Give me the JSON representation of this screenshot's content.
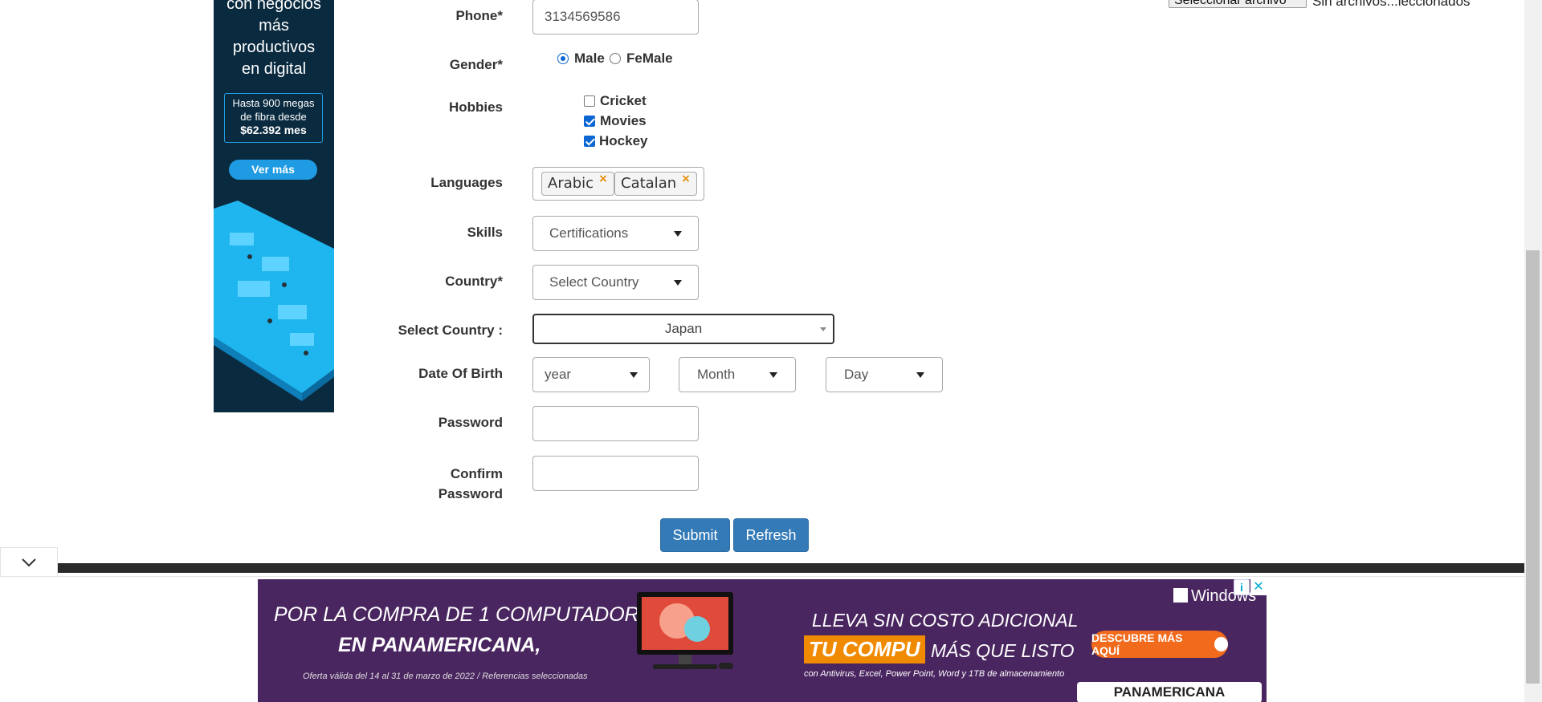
{
  "side_ad": {
    "heading_lines": [
      "con negocios",
      "más",
      "productivos",
      "en digital"
    ],
    "offer_line1": "Hasta 900 megas",
    "offer_line2": "de fibra desde",
    "offer_price": "$62.392 mes",
    "cta": "Ver más"
  },
  "file_upload": {
    "button_label": "Seleccionar archivo",
    "status": "Sin archivos...leccionados"
  },
  "form": {
    "phone": {
      "label": "Phone*",
      "value": "3134569586"
    },
    "gender": {
      "label": "Gender*",
      "options": [
        "Male",
        "FeMale"
      ],
      "selected": "Male"
    },
    "hobbies": {
      "label": "Hobbies",
      "items": [
        {
          "label": "Cricket",
          "checked": false
        },
        {
          "label": "Movies",
          "checked": true
        },
        {
          "label": "Hockey",
          "checked": true
        }
      ]
    },
    "languages": {
      "label": "Languages",
      "tags": [
        "Arabic",
        "Catalan"
      ],
      "remove_glyph": "×"
    },
    "skills": {
      "label": "Skills",
      "value": "Certifications"
    },
    "country": {
      "label": "Country*",
      "value": "Select Country"
    },
    "select_country": {
      "label": "Select Country :",
      "value": "Japan"
    },
    "dob": {
      "label": "Date Of Birth",
      "year": "year",
      "month": "Month",
      "day": "Day"
    },
    "password": {
      "label": "Password",
      "value": ""
    },
    "confirm_password": {
      "label_line1": "Confirm",
      "label_line2": "Password",
      "value": ""
    },
    "submit_label": "Submit",
    "refresh_label": "Refresh"
  },
  "bottom_ad": {
    "line1": "POR LA COMPRA DE 1 COMPUTADOR",
    "line2": "EN PANAMERICANA,",
    "line3": "Oferta válida del 14 al 31 de marzo de 2022 / Referencias seleccionadas",
    "line4": "LLEVA SIN COSTO ADICIONAL",
    "line5": "TU COMPU",
    "line6": "MÁS QUE LISTO",
    "line7": "con Antivirus, Excel, Power Point, Word y 1TB de almacenamiento",
    "windows": "Windows",
    "cta": "DESCUBRE MÁS AQUÍ",
    "brand": "PANAMERICANA",
    "info_glyph": "i",
    "close_glyph": "✕"
  },
  "colors": {
    "primary_button": "#337ab7",
    "side_ad_bg": "#0a2a3f",
    "bottom_ad_bg": "#4a2660",
    "accent_orange": "#f08a00"
  }
}
